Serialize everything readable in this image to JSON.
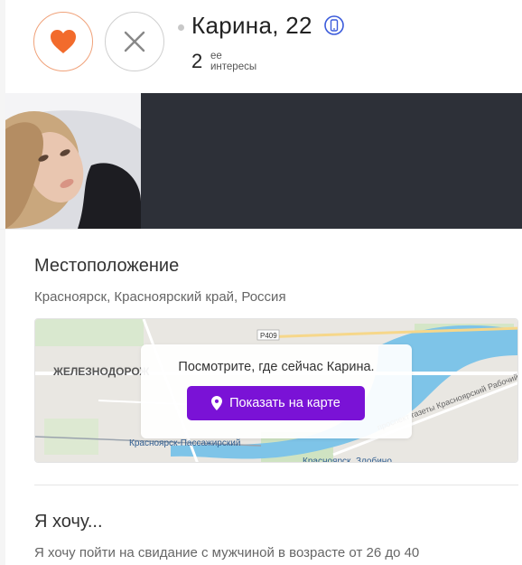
{
  "profile": {
    "name": "Карина, 22",
    "interests_count": "2",
    "interests_label_line1": "ее",
    "interests_label_line2": "интересы",
    "like_icon": "heart-icon",
    "skip_icon": "close-icon",
    "device_icon": "mobile-phone-icon"
  },
  "location": {
    "title": "Местоположение",
    "address": "Красноярск, Красноярский край, Россия",
    "map": {
      "overlay_text": "Посмотрите, где сейчас Карина.",
      "button_label": "Показать на карте",
      "labels": {
        "district": "ЖЕЛЕЗНОДОРОЖ",
        "road": "Р409",
        "station1": "Красноярск-Пассажирский",
        "station2": "Красноярск, Злобино",
        "street": "проспект газеты Красноярский Рабочий"
      }
    }
  },
  "wants": {
    "title": "Я хочу...",
    "text": "Я хочу пойти на свидание с мужчиной в возрасте от 26 до 40"
  },
  "colors": {
    "accent_orange": "#f26b2c",
    "primary_purple": "#7a12d6",
    "photo_strip_bg": "#2d3038",
    "online_icon_blue": "#3b5bdb"
  }
}
